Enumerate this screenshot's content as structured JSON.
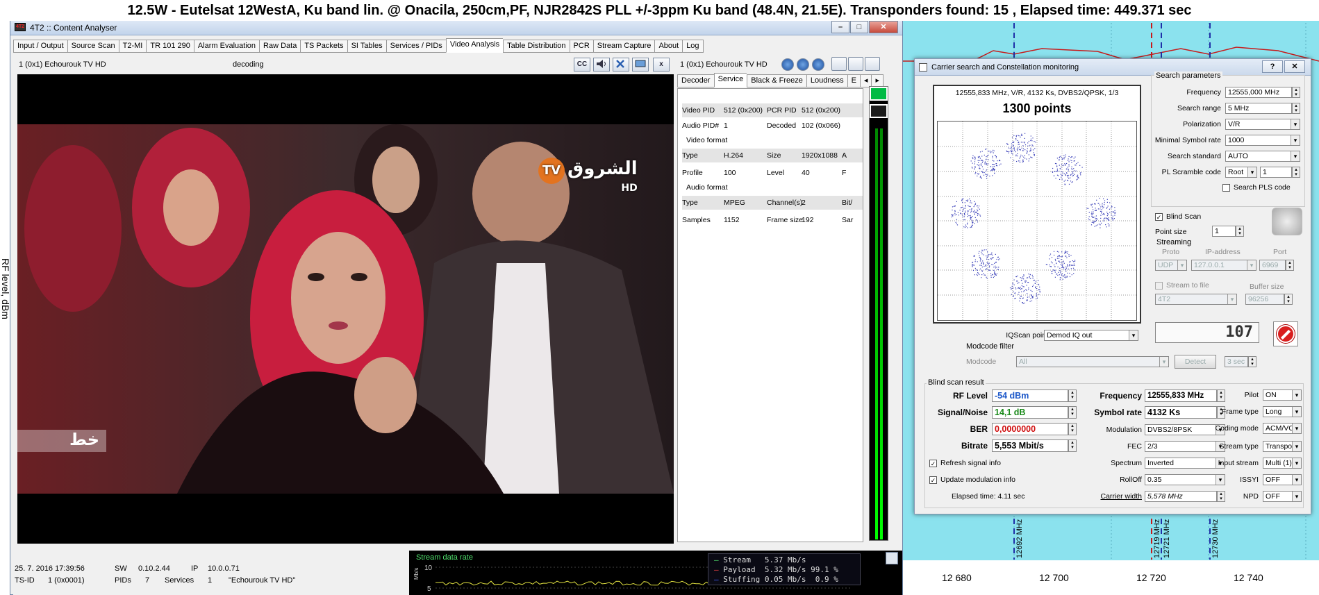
{
  "banner": "12.5W - Eutelsat 12WestA, Ku  band lin. @ Onacila, 250cm,PF, NJR2842S PLL +/-3ppm Ku band (48.4N, 21.5E). Transponders found: 15 , Elapsed time: 449.371 sec",
  "spectrum": {
    "y_axis_label": "RF level, dBm",
    "x_ticks": [
      "12 680",
      "12 700",
      "12 720",
      "12 740"
    ],
    "markers": [
      "12692 MHz",
      "12719 MHz",
      "12721 MHz",
      "12730 MHz"
    ],
    "colors": {
      "background": "#8be2ee",
      "marker": "#1f2fa8",
      "marker_red": "#c81a1a"
    }
  },
  "analyser": {
    "title": "4T2 :: Content Analyser",
    "app_icon": "4T2",
    "window_buttons": {
      "minimize": "–",
      "maximize": "□",
      "close": "✕"
    },
    "tabs": [
      "Input / Output",
      "Source Scan",
      "T2-MI",
      "TR 101 290",
      "Alarm Evaluation",
      "Raw Data",
      "TS Packets",
      "SI Tables",
      "Services / PIDs",
      "Video Analysis",
      "Table Distribution",
      "PCR",
      "Stream Capture",
      "About",
      "Log"
    ],
    "active_tab": "Video Analysis",
    "video_header": {
      "service": "1 (0x1) Echourouk TV HD",
      "state": "decoding",
      "buttons": [
        "cc-icon",
        "speaker-icon",
        "tools-icon",
        "monitor-icon",
        "close-icon"
      ],
      "close_label": "x",
      "cc_label": "CC"
    },
    "video": {
      "watermark_text": "الشروق",
      "watermark_tv": "TV",
      "watermark_hd": "HD",
      "corner_logo": "خط"
    },
    "side_panel": {
      "service": "1 (0x1) Echourouk TV HD",
      "tabs": [
        "Decoder",
        "Service",
        "Black & Freeze",
        "Loudness",
        "E"
      ],
      "active_tab": "Service",
      "rows": [
        {
          "k1": "Video PID",
          "v1": "512 (0x200)",
          "k2": "PCR PID",
          "v2": "512 (0x200)"
        },
        {
          "k1": "Audio PID#",
          "v1": "1",
          "k2": "Decoded",
          "v2": "102 (0x066)"
        },
        {
          "k1": "Type",
          "v1": "H.264",
          "k2": "Size",
          "v2": "1920x1088",
          "v3": "A"
        },
        {
          "k1": "Profile",
          "v1": "100",
          "k2": "Level",
          "v2": "40",
          "v3": "F"
        },
        {
          "k1": "Type",
          "v1": "MPEG",
          "k2": "Channel(s)",
          "v2": "2",
          "v3": "Bit/"
        },
        {
          "k1": "Samples",
          "v1": "1152",
          "k2": "Frame size",
          "v2": "192",
          "v3": "Sar"
        }
      ],
      "sections": {
        "video": "Video format",
        "audio": "Audio format"
      }
    },
    "status": {
      "date": "25. 7. 2016 17:39:56",
      "sw_label": "SW",
      "sw_value": "0.10.2.44",
      "ip_label": "IP",
      "ip_value": "10.0.0.71",
      "tsid_label": "TS-ID",
      "tsid_value": "1 (0x0001)",
      "pids_label": "PIDs",
      "pids_value": "7",
      "services_label": "Services",
      "services_value": "1",
      "service_name": "\"Echourouk TV HD\""
    },
    "stream": {
      "title": "Stream data rate",
      "y10": "10",
      "y5": "5",
      "axis_unit": "Mb/s",
      "legend": [
        {
          "name": "Stream",
          "value": "5.37 Mb/s",
          "pct": "",
          "color": "#4fe06c"
        },
        {
          "name": "Payload",
          "value": "5.32 Mb/s",
          "pct": "99.1 %",
          "color": "#e04040"
        },
        {
          "name": "Stuffing",
          "value": "0.05 Mb/s",
          "pct": "0.9 %",
          "color": "#4060ff"
        }
      ]
    }
  },
  "carrier": {
    "title": "Carrier search and Constellation monitoring",
    "help": "?",
    "close": "✕",
    "constellation": {
      "header": "12555,833 MHz, V/R, 4132 Ks, DVBS2/QPSK, 1/3",
      "points": "1300 points",
      "clusters": [
        [
          0.42,
          0.13
        ],
        [
          0.24,
          0.21
        ],
        [
          0.65,
          0.24
        ],
        [
          0.14,
          0.46
        ],
        [
          0.82,
          0.46
        ],
        [
          0.24,
          0.72
        ],
        [
          0.62,
          0.72
        ],
        [
          0.44,
          0.84
        ]
      ]
    },
    "search": {
      "group": "Search parameters",
      "frequency_label": "Frequency",
      "frequency": "12555,000 MHz",
      "range_label": "Search range",
      "range": "5 MHz",
      "polarization_label": "Polarization",
      "polarization": "V/R",
      "min_sr_label": "Minimal Symbol rate",
      "min_sr": "1000",
      "standard_label": "Search standard",
      "standard": "AUTO",
      "pls_label": "PL Scramble code",
      "pls_mode": "Root",
      "pls_value": "1",
      "search_pls": "Search PLS code",
      "blind_scan": "Blind Scan",
      "point_size_label": "Point size",
      "point_size": "1"
    },
    "streaming": {
      "group": "Streaming",
      "proto_label": "Proto",
      "ip_label": "IP-address",
      "port_label": "Port",
      "proto": "UDP",
      "ip": "127.0.0.1",
      "port": "6969",
      "to_file": "Stream to file",
      "buffer_label": "Buffer size",
      "file": "4T2",
      "buffer": "96256"
    },
    "counter": "107",
    "iqscan_label": "IQScan point",
    "iqscan": "Demod IQ out",
    "modcode": {
      "group": "Modcode filter",
      "label": "Modcode",
      "value": "All",
      "detect": "Detect",
      "timeout": "3 sec"
    },
    "result": {
      "group": "Blind scan result",
      "rf_label": "RF Level",
      "rf": "-54 dBm",
      "sn_label": "Signal/Noise",
      "sn": "14,1 dB",
      "ber_label": "BER",
      "ber": "0,0000000",
      "bitrate_label": "Bitrate",
      "bitrate": "5,553 Mbit/s",
      "freq_label": "Frequency",
      "freq": "12555,833 MHz",
      "sr_label": "Symbol rate",
      "sr": "4132 Ks",
      "mod_label": "Modulation",
      "mod": "DVBS2/8PSK",
      "fec_label": "FEC",
      "fec": "2/3",
      "spectrum_label": "Spectrum",
      "spectrum": "Inverted",
      "rolloff_label": "RollOff",
      "rolloff": "0.35",
      "cw_label": "Carrier width",
      "cw": "5,578 MHz",
      "pilot_label": "Pilot",
      "pilot": "ON",
      "frame_label": "Frame type",
      "frame": "Long",
      "coding_label": "Coding mode",
      "coding": "ACM/VCM",
      "stype_label": "Stream type",
      "stype": "Transport",
      "istream_label": "Input stream",
      "istream": "Multi (1)",
      "issyi_label": "ISSYI",
      "issyi": "OFF",
      "npd_label": "NPD",
      "npd": "OFF",
      "refresh": "Refresh signal info",
      "update": "Update modulation info",
      "elapsed": "Elapsed time: 4.11 sec",
      "colors": {
        "rf": "#1a56c8",
        "sn": "#1a8a1a",
        "ber": "#d01010"
      }
    }
  }
}
